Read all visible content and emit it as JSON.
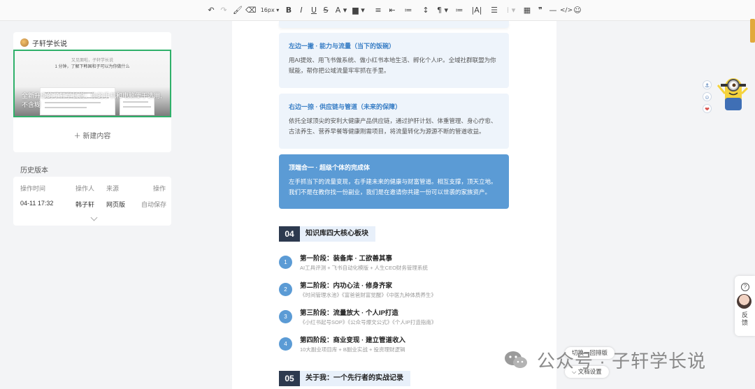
{
  "toolbar": {
    "undo": "↶",
    "redo": "↷",
    "format_painter": "🖌",
    "clear": "⌫",
    "font_size": "16px ▾",
    "bold": "B",
    "italic": "I",
    "underline": "U",
    "strike": "S",
    "font_color": "A ▾",
    "bg_color": "▆ ▾",
    "align": "≡ ▾",
    "indent": "⇤",
    "list1": "≔ ▾",
    "line_height": "↕ ▾",
    "paragraph": "¶ ▾",
    "letter_spacing": "|A| ▾",
    "bullet": "☰ ▾",
    "number": "⁞ ▾",
    "table": "▦",
    "quote": "❞",
    "hr": "—",
    "code": "</>",
    "emoji": "☺"
  },
  "card": {
    "title": "子轩学长说",
    "preview_line1": "又见面啦，子轩学长说",
    "preview_line2": "1 分钟，了解下韩国和子可以为你做什么",
    "preview_overlay_line1": "全新升级的子轩学长说：你的手机和电脑便于选用,",
    "preview_overlay_line2": "不含糊",
    "new_content": "＋ 新建内容"
  },
  "history": {
    "label": "历史版本",
    "headers": [
      "操作时间",
      "操作人",
      "来源",
      "操作"
    ],
    "row": [
      "04-11 17:32",
      "韩子轩",
      "网页版",
      "自动保存"
    ]
  },
  "doc": {
    "boxes": [
      {
        "title": "左边一撇 · 能力与流量（当下的饭碗）",
        "body": "用AI提效、用飞书做系统、做小红书本地生活、孵化个人IP。全域社群联盟为你赋能，帮你把公域流量牢牢抓在手里。"
      },
      {
        "title": "右边一捺 · 供应链与管道（未来的保障）",
        "body": "依托全球顶尖的安利大健康产品供应链，通过护肝计划、体重管理、身心疗愈、古法养生、营养早餐等健康刚需项目，将流量转化为源源不断的管道收益。"
      },
      {
        "title": "顶端合一 · 超级个体的完成体",
        "body": "左手抓当下的流量变现，右手建未来的健康与财富管道。相互支撑，顶天立地。我们不是在教你找一份副业，我们是在邀请你共建一份可以世袭的家族资产。"
      }
    ],
    "sections": [
      {
        "num": "04",
        "title": "知识库四大核心板块"
      },
      {
        "num": "05",
        "title": "关于我：一个先行者的实战记录"
      }
    ],
    "stages": [
      {
        "num": "1",
        "title": "第一阶段：装备库 · 工欲善其事",
        "sub": "AI工具评测 + 飞书自动化模版 + 人生CEO财务管理系统"
      },
      {
        "num": "2",
        "title": "第二阶段：内功心法 · 修身齐家",
        "sub": "《时间管理水池》《富爸爸财富觉醒》《中医九种体质养生》"
      },
      {
        "num": "3",
        "title": "第三阶段：流量放大 · 个人IP打造",
        "sub": "《小红书起号SOP》《公众号爆文公式》《个人IP打造指南》"
      },
      {
        "num": "4",
        "title": "第四阶段：商业变现 · 建立管道收入",
        "sub": "10大副业项目库 + B副业实战 + 投资理财逻辑"
      }
    ]
  },
  "side": {
    "icons": [
      "⚓",
      "☺",
      "❤"
    ],
    "feedback": "反馈",
    "feedback_q": "?",
    "float_top": "切换一回排版",
    "float_bottom": "⌵ 文档设置"
  },
  "watermark": "公众号 · 子轩学长说",
  "colors": {
    "accent": "#5b9bd5",
    "dark": "#2d3a4f",
    "green": "#2fb06a",
    "light_box": "#eef4fb"
  }
}
